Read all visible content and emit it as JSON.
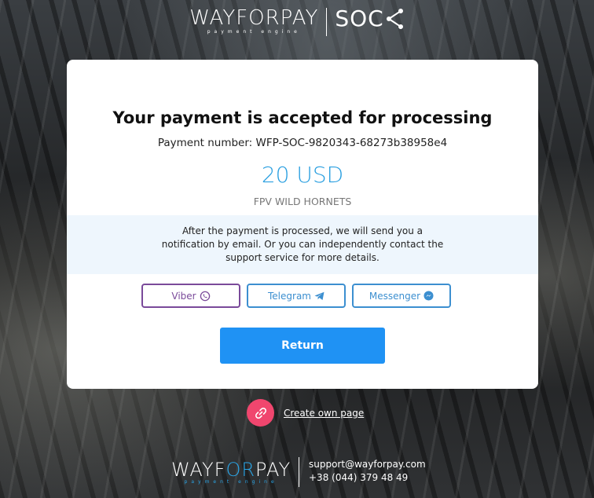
{
  "header": {
    "logo_word": "WAYFORPAY",
    "logo_tagline": "payment engine",
    "partner_logo": "SOC",
    "share_icon": "share-icon"
  },
  "card": {
    "title": "Your payment is accepted for processing",
    "payment_number": "Payment number: WFP-SOC-9820343-68273b38958e4",
    "amount": "20 USD",
    "merchant": "FPV WILD HORNETS",
    "notice": "After the payment is processed, we will send you a notification by email. Or you can independently contact the support service for more details.",
    "contacts": [
      {
        "label": "Viber",
        "icon": "viber-icon",
        "color": "#7a4a9a"
      },
      {
        "label": "Telegram",
        "icon": "telegram-icon",
        "color": "#3c8fd0"
      },
      {
        "label": "Messenger",
        "icon": "messenger-icon",
        "color": "#3c8fd0"
      }
    ],
    "return_label": "Return"
  },
  "create_page": {
    "label": "Create own page",
    "icon": "link-icon",
    "icon_bg": "#f0466e"
  },
  "footer": {
    "logo_word_a": "WAYF",
    "logo_word_b": "OR",
    "logo_word_c": "PAY",
    "logo_tagline": "payment engine",
    "email": "support@wayforpay.com",
    "phone": "+38 (044) 379 48 49"
  },
  "colors": {
    "accent": "#1f92f4",
    "amount": "#2a9fe0",
    "notice_bg": "#eef6fd"
  }
}
